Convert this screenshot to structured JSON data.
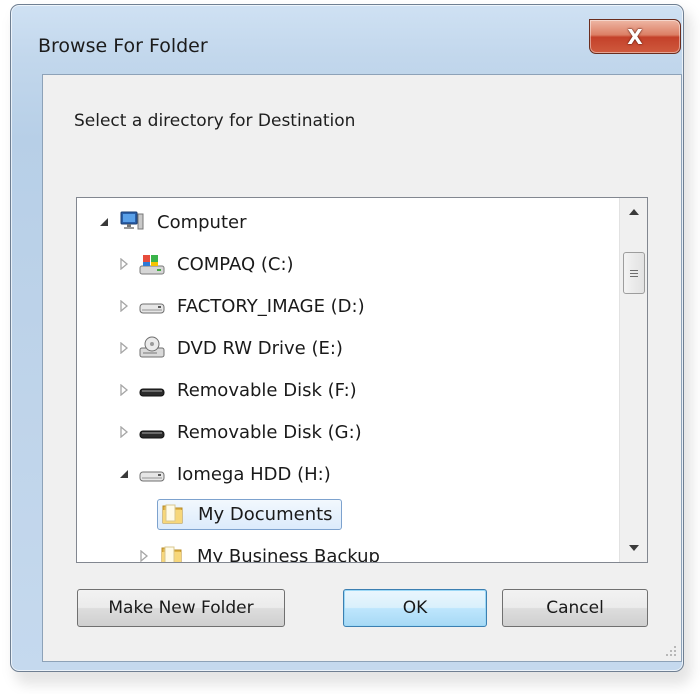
{
  "window": {
    "title": "Browse For Folder",
    "close_label": "X"
  },
  "prompt": "Select a directory for Destination",
  "tree": {
    "items": [
      {
        "label": "Computer",
        "icon": "computer-icon",
        "level": 0,
        "expander": "expanded",
        "selected": false
      },
      {
        "label": "COMPAQ (C:)",
        "icon": "system-drive-icon",
        "level": 1,
        "expander": "collapsed",
        "selected": false
      },
      {
        "label": "FACTORY_IMAGE (D:)",
        "icon": "hard-drive-icon",
        "level": 1,
        "expander": "collapsed",
        "selected": false
      },
      {
        "label": "DVD RW Drive (E:)",
        "icon": "dvd-drive-icon",
        "level": 1,
        "expander": "collapsed",
        "selected": false
      },
      {
        "label": "Removable Disk (F:)",
        "icon": "removable-disk-icon",
        "level": 1,
        "expander": "collapsed",
        "selected": false
      },
      {
        "label": "Removable Disk (G:)",
        "icon": "removable-disk-icon",
        "level": 1,
        "expander": "collapsed",
        "selected": false
      },
      {
        "label": "Iomega HDD (H:)",
        "icon": "hard-drive-icon",
        "level": 1,
        "expander": "expanded",
        "selected": false
      },
      {
        "label": "My Documents",
        "icon": "folder-icon",
        "level": 2,
        "expander": "none",
        "selected": true
      },
      {
        "label": "My Business Backup",
        "icon": "folder-icon",
        "level": 2,
        "expander": "collapsed",
        "selected": false
      }
    ]
  },
  "buttons": {
    "make_new_folder": "Make New Folder",
    "ok": "OK",
    "cancel": "Cancel"
  },
  "colors": {
    "selection_border": "#7da2ce",
    "selection_fill": "#dcebfc",
    "close_button": "#c4412a",
    "default_button": "#bee6fd"
  }
}
